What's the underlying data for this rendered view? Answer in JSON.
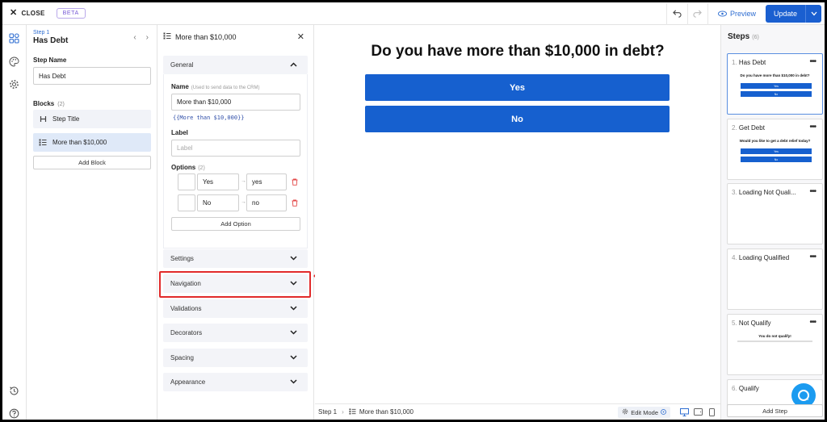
{
  "topbar": {
    "close_label": "CLOSE",
    "beta_badge": "BETA",
    "preview_label": "Preview",
    "update_label": "Update"
  },
  "step_panel": {
    "kicker": "Step 1",
    "title": "Has Debt",
    "step_name_label": "Step Name",
    "step_name_value": "Has Debt",
    "blocks_label": "Blocks",
    "blocks_count": "(2)",
    "blocks": [
      {
        "label": "Step Title",
        "icon": "heading-icon"
      },
      {
        "label": "More than $10,000",
        "icon": "list-options-icon"
      }
    ],
    "add_block_label": "Add Block"
  },
  "block_panel": {
    "title": "More than $10,000",
    "general": {
      "header": "General",
      "name_label": "Name",
      "name_hint": "(Used to send data to the CRM)",
      "name_value": "More than $10,000",
      "token": "{{More than $10,000}}",
      "label_label": "Label",
      "label_placeholder": "Label",
      "options_label": "Options",
      "options_count": "(2)",
      "options": [
        {
          "label": "Yes",
          "value": "yes"
        },
        {
          "label": "No",
          "value": "no"
        }
      ],
      "add_option_label": "Add Option"
    },
    "sections": [
      "Settings",
      "Navigation",
      "Validations",
      "Decorators",
      "Spacing",
      "Appearance"
    ]
  },
  "canvas": {
    "question": "Do you have more than $10,000 in debt?",
    "choices": [
      "Yes",
      "No"
    ]
  },
  "statusbar": {
    "step": "Step 1",
    "block": "More than $10,000",
    "edit_mode": "Edit Mode"
  },
  "steps": {
    "header": "Steps",
    "count": "(6)",
    "items": [
      {
        "num": "1.",
        "name": "Has Debt",
        "question": "Do you have more than $10,000 in debt?",
        "buttons": [
          "Yes",
          "No"
        ]
      },
      {
        "num": "2.",
        "name": "Get Debt",
        "question": "Would you like to get a debt relief today?",
        "buttons": [
          "Yes",
          "No"
        ]
      },
      {
        "num": "3.",
        "name": "Loading Not Quali...",
        "question": "",
        "buttons": []
      },
      {
        "num": "4.",
        "name": "Loading Qualified",
        "question": "",
        "buttons": []
      },
      {
        "num": "5.",
        "name": "Not Qualify",
        "question": "You do not qualify!",
        "buttons": []
      },
      {
        "num": "6.",
        "name": "Qualify",
        "question": "",
        "buttons": []
      }
    ],
    "add_step_label": "Add Step"
  }
}
